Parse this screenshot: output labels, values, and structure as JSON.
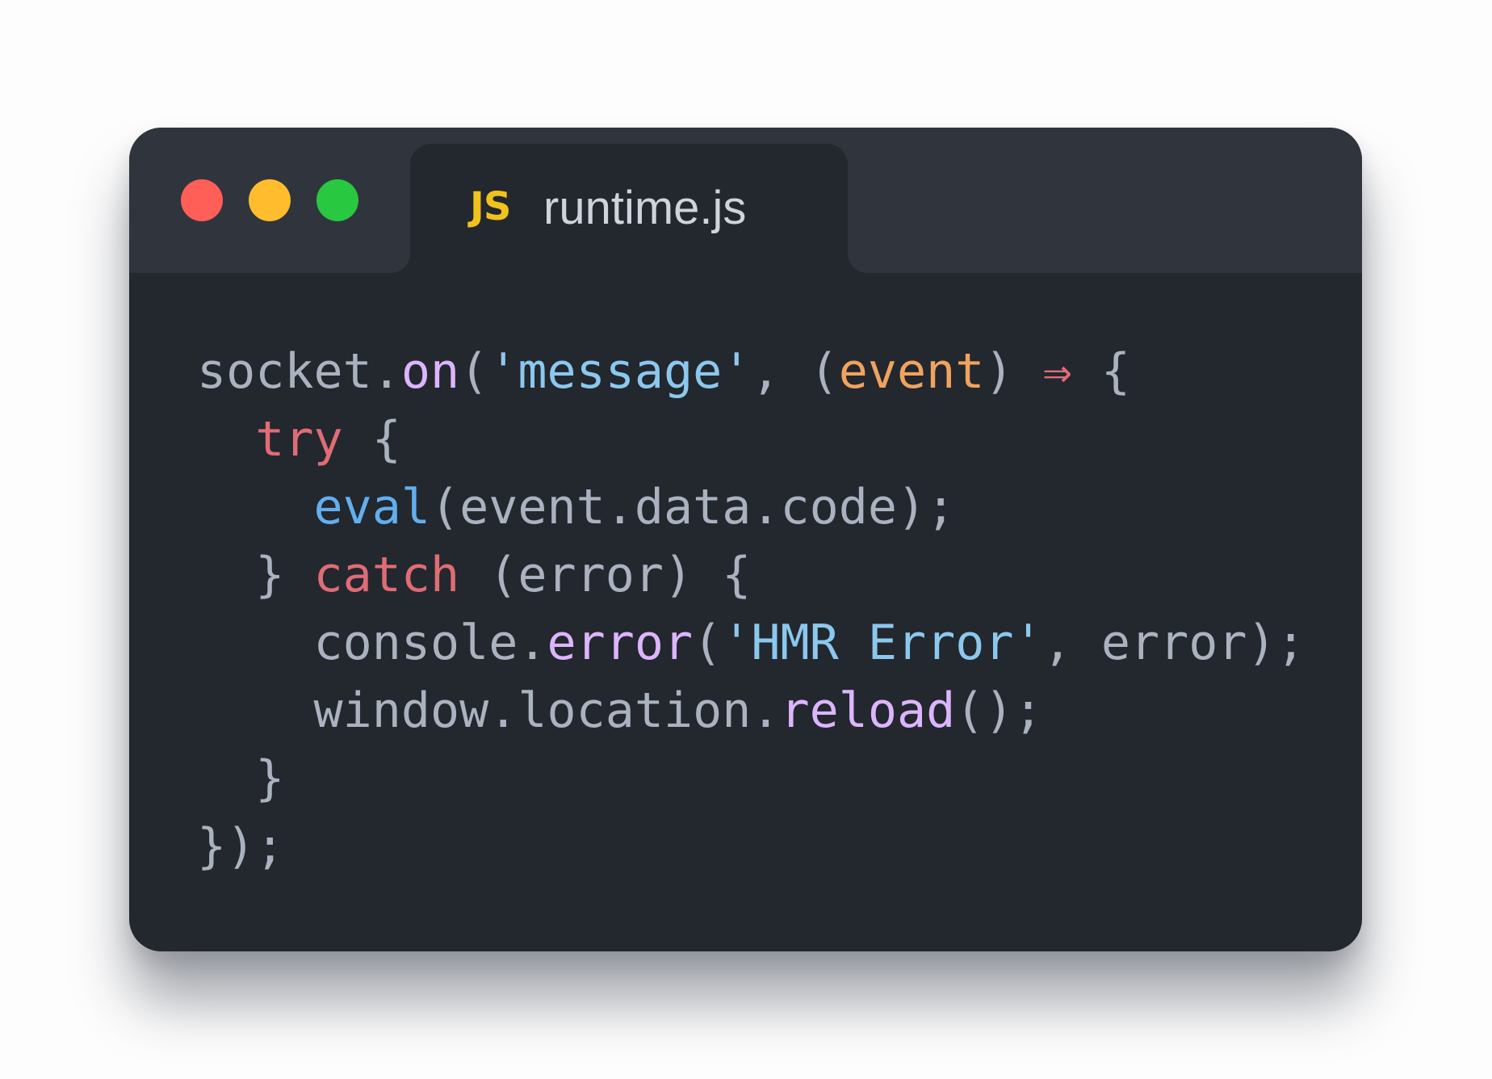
{
  "colors": {
    "close": "#ff5f57",
    "minimize": "#ffbd2e",
    "zoom": "#28c840",
    "js_badge": "#f1c21b"
  },
  "window": {
    "controls": [
      {
        "name": "close",
        "color": "#ff5f57"
      },
      {
        "name": "minimize",
        "color": "#ffbd2e"
      },
      {
        "name": "zoom",
        "color": "#28c840"
      }
    ],
    "tab": {
      "icon_text": "JS",
      "icon": "javascript-file-icon",
      "label": "runtime.js"
    }
  },
  "code": {
    "language": "javascript",
    "lines": [
      [
        {
          "text": "socket.",
          "type": "plain"
        },
        {
          "text": "on",
          "type": "fn"
        },
        {
          "text": "(",
          "type": "plain"
        },
        {
          "text": "'message'",
          "type": "str"
        },
        {
          "text": ", (",
          "type": "plain"
        },
        {
          "text": "event",
          "type": "param"
        },
        {
          "text": ") ",
          "type": "plain"
        },
        {
          "text": "⇒",
          "type": "kw"
        },
        {
          "text": " {",
          "type": "plain"
        }
      ],
      [
        {
          "text": "  ",
          "type": "plain"
        },
        {
          "text": "try",
          "type": "kw"
        },
        {
          "text": " {",
          "type": "plain"
        }
      ],
      [
        {
          "text": "    ",
          "type": "plain"
        },
        {
          "text": "eval",
          "type": "call"
        },
        {
          "text": "(event.data.code);",
          "type": "plain"
        }
      ],
      [
        {
          "text": "  } ",
          "type": "plain"
        },
        {
          "text": "catch",
          "type": "kw"
        },
        {
          "text": " (error) {",
          "type": "plain"
        }
      ],
      [
        {
          "text": "    console.",
          "type": "plain"
        },
        {
          "text": "error",
          "type": "fn"
        },
        {
          "text": "(",
          "type": "plain"
        },
        {
          "text": "'HMR Error'",
          "type": "str"
        },
        {
          "text": ", error);",
          "type": "plain"
        }
      ],
      [
        {
          "text": "    window.location.",
          "type": "plain"
        },
        {
          "text": "reload",
          "type": "fn"
        },
        {
          "text": "();",
          "type": "plain"
        }
      ],
      [
        {
          "text": "  }",
          "type": "plain"
        }
      ],
      [
        {
          "text": "});",
          "type": "plain"
        }
      ]
    ]
  }
}
